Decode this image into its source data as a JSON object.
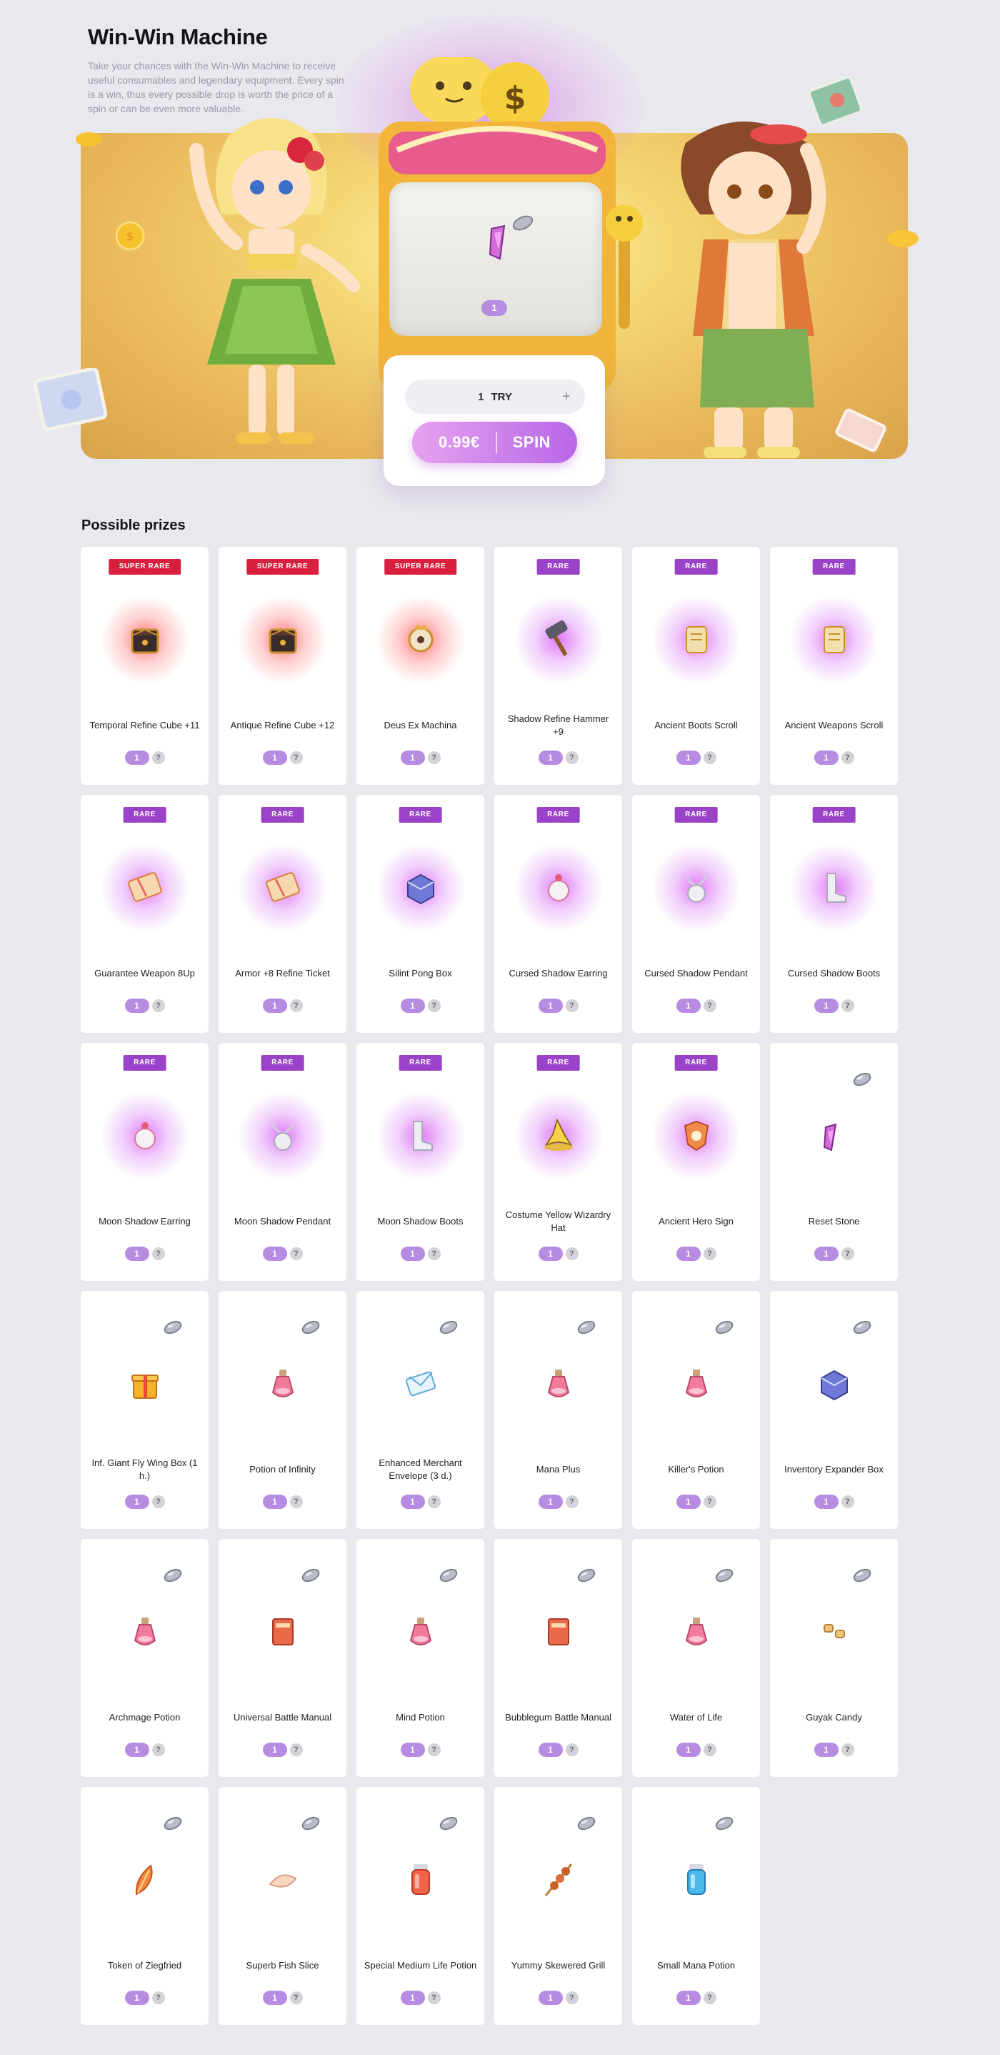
{
  "hero": {
    "title": "Win-Win Machine",
    "description": "Take your chances with the Win-Win Machine to receive useful consumables and legendary equipment. Every spin is a win, thus every possible drop is worth the price of a spin or can be even more valuable.",
    "screen_qty": "1",
    "try_count": "1",
    "try_label": "TRY",
    "plus_label": "+",
    "price": "0.99€",
    "spin_label": "SPIN"
  },
  "prizes": {
    "heading": "Possible prizes",
    "items": [
      {
        "name": "Temporal Refine Cube +11",
        "rarity": "SUPER RARE",
        "qty": "1",
        "icon": "dark-cube-icon"
      },
      {
        "name": "Antique Refine Cube +12",
        "rarity": "SUPER RARE",
        "qty": "1",
        "icon": "dark-cube-icon"
      },
      {
        "name": "Deus Ex Machina",
        "rarity": "SUPER RARE",
        "qty": "1",
        "icon": "machina-icon"
      },
      {
        "name": "Shadow Refine Hammer +9",
        "rarity": "RARE",
        "qty": "1",
        "icon": "hammer-icon"
      },
      {
        "name": "Ancient Boots Scroll",
        "rarity": "RARE",
        "qty": "1",
        "icon": "scroll-icon"
      },
      {
        "name": "Ancient Weapons Scroll",
        "rarity": "RARE",
        "qty": "1",
        "icon": "scroll-icon"
      },
      {
        "name": "Guarantee Weapon 8Up",
        "rarity": "RARE",
        "qty": "1",
        "icon": "ticket-icon"
      },
      {
        "name": "Armor +8 Refine Ticket",
        "rarity": "RARE",
        "qty": "1",
        "icon": "ticket-icon"
      },
      {
        "name": "Silint Pong Box",
        "rarity": "RARE",
        "qty": "1",
        "icon": "box-icon"
      },
      {
        "name": "Cursed Shadow Earring",
        "rarity": "RARE",
        "qty": "1",
        "icon": "earring-icon"
      },
      {
        "name": "Cursed Shadow Pendant",
        "rarity": "RARE",
        "qty": "1",
        "icon": "pendant-icon"
      },
      {
        "name": "Cursed Shadow Boots",
        "rarity": "RARE",
        "qty": "1",
        "icon": "boots-icon"
      },
      {
        "name": "Moon Shadow Earring",
        "rarity": "RARE",
        "qty": "1",
        "icon": "earring-icon"
      },
      {
        "name": "Moon Shadow Pendant",
        "rarity": "RARE",
        "qty": "1",
        "icon": "pendant-icon"
      },
      {
        "name": "Moon Shadow Boots",
        "rarity": "RARE",
        "qty": "1",
        "icon": "boots-icon"
      },
      {
        "name": "Costume Yellow Wizardry Hat",
        "rarity": "RARE",
        "qty": "1",
        "icon": "hat-icon"
      },
      {
        "name": "Ancient Hero Sign",
        "rarity": "RARE",
        "qty": "1",
        "icon": "sign-icon"
      },
      {
        "name": "Reset Stone",
        "rarity": "",
        "qty": "1",
        "icon": "stone-icon"
      },
      {
        "name": "Inf. Giant Fly Wing Box (1 h.)",
        "rarity": "",
        "qty": "1",
        "icon": "gift-box-icon"
      },
      {
        "name": "Potion of Infinity",
        "rarity": "",
        "qty": "1",
        "icon": "potion-icon"
      },
      {
        "name": "Enhanced Merchant Envelope (3 d.)",
        "rarity": "",
        "qty": "1",
        "icon": "envelope-icon"
      },
      {
        "name": "Mana Plus",
        "rarity": "",
        "qty": "1",
        "icon": "potion-icon"
      },
      {
        "name": "Killer's Potion",
        "rarity": "",
        "qty": "1",
        "icon": "potion-icon"
      },
      {
        "name": "Inventory Expander Box",
        "rarity": "",
        "qty": "1",
        "icon": "box-icon"
      },
      {
        "name": "Archmage Potion",
        "rarity": "",
        "qty": "1",
        "icon": "potion-icon"
      },
      {
        "name": "Universal Battle Manual",
        "rarity": "",
        "qty": "1",
        "icon": "book-icon"
      },
      {
        "name": "Mind Potion",
        "rarity": "",
        "qty": "1",
        "icon": "potion-icon"
      },
      {
        "name": "Bubblegum Battle Manual",
        "rarity": "",
        "qty": "1",
        "icon": "book-icon"
      },
      {
        "name": "Water of Life",
        "rarity": "",
        "qty": "1",
        "icon": "potion-icon"
      },
      {
        "name": "Guyak Candy",
        "rarity": "",
        "qty": "1",
        "icon": "candy-icon"
      },
      {
        "name": "Token of Ziegfried",
        "rarity": "",
        "qty": "1",
        "icon": "feather-icon"
      },
      {
        "name": "Superb Fish Slice",
        "rarity": "",
        "qty": "1",
        "icon": "fish-slice-icon"
      },
      {
        "name": "Special Medium Life Potion",
        "rarity": "",
        "qty": "1",
        "icon": "jar-icon"
      },
      {
        "name": "Yummy Skewered Grill",
        "rarity": "",
        "qty": "1",
        "icon": "skewer-icon"
      },
      {
        "name": "Small Mana Potion",
        "rarity": "",
        "qty": "1",
        "icon": "jar-icon"
      }
    ]
  },
  "colors": {
    "super_rare": "#d8203e",
    "rare": "#9a42c8",
    "qty_badge": "#b78be0",
    "spin_gradient_start": "#e6a2f0",
    "spin_gradient_end": "#b867e6"
  }
}
